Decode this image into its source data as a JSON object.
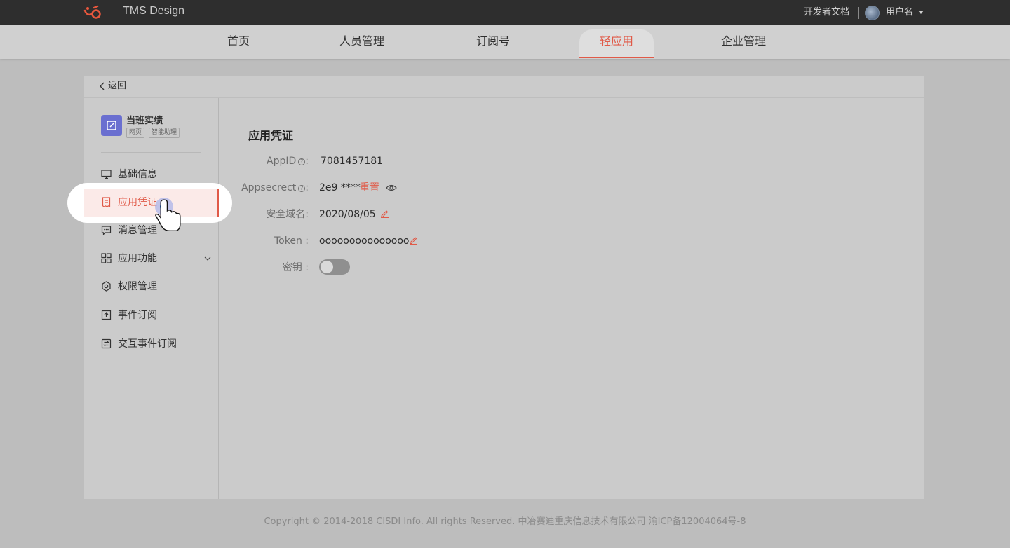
{
  "header": {
    "brand": "TMS Design",
    "dev_docs": "开发者文档",
    "username": "用户名"
  },
  "nav": {
    "items": [
      {
        "label": "首页"
      },
      {
        "label": "人员管理"
      },
      {
        "label": "订阅号"
      },
      {
        "label": "轻应用"
      },
      {
        "label": "企业管理"
      }
    ],
    "active": "轻应用"
  },
  "back": {
    "label": "返回"
  },
  "app": {
    "name": "当班实绩",
    "tags": [
      "网页",
      "智能助理"
    ]
  },
  "sidebar": {
    "items": [
      {
        "label": "基础信息",
        "icon": "monitor-icon"
      },
      {
        "label": "应用凭证",
        "icon": "receipt-icon"
      },
      {
        "label": "消息管理",
        "icon": "message-icon"
      },
      {
        "label": "应用功能",
        "icon": "grid-icon"
      },
      {
        "label": "权限管理",
        "icon": "settings-icon"
      },
      {
        "label": "事件订阅",
        "icon": "bookmark-icon"
      },
      {
        "label": "交互事件订阅",
        "icon": "interaction-icon"
      }
    ],
    "active": "应用凭证"
  },
  "credentials": {
    "title": "应用凭证",
    "appid_label": "AppID",
    "appid_value": "7081457181",
    "secret_label": "Appsecrect",
    "secret_value": "2e9 ****",
    "reset_label": "重置",
    "domain_label": "安全域名:",
    "domain_value": "2020/08/05",
    "token_label": "Token :",
    "token_value": "ooooooooooooooo",
    "key_label": "密钥 :",
    "key_enabled": false
  },
  "footer": {
    "text": "Copyright © 2014-2018 CISDI Info. All rights Reserved. 中冶赛迪重庆信息技术有限公司 渝ICP备12004064号-8"
  },
  "colors": {
    "accent": "#e05a48",
    "app_icon": "#6a6fd0",
    "topbar": "#2e2e2e"
  }
}
